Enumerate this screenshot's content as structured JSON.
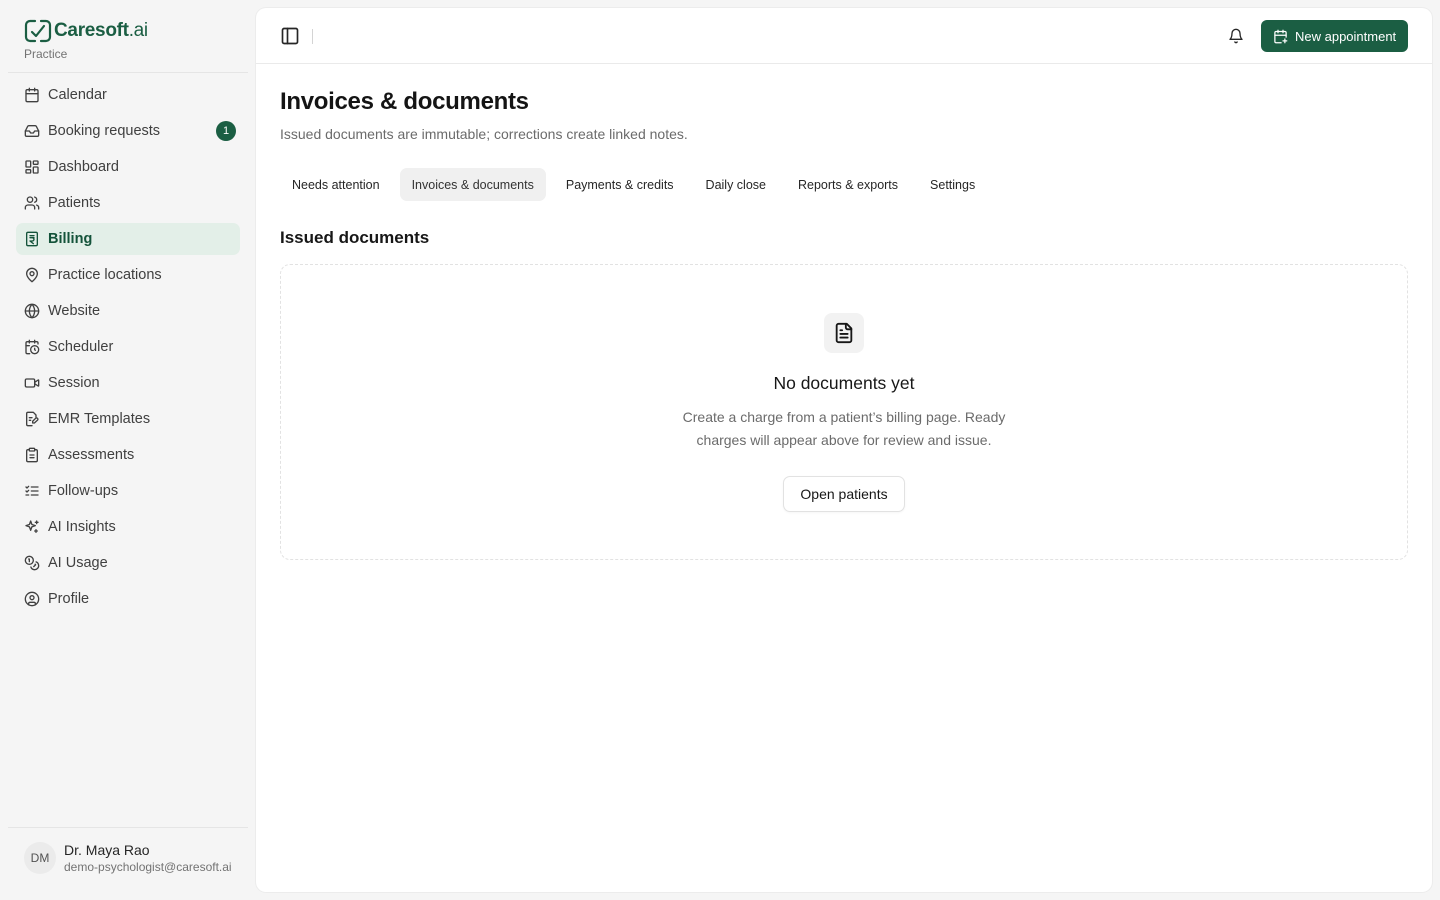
{
  "brand": {
    "name": "Caresoft",
    "name_suffix": ".ai",
    "subtitle": "Practice",
    "color": "#1b5e43"
  },
  "sidebar": {
    "items": [
      {
        "label": "Calendar",
        "icon": "calendar-icon"
      },
      {
        "label": "Booking requests",
        "icon": "inbox-icon",
        "badge": "1"
      },
      {
        "label": "Dashboard",
        "icon": "dashboard-icon"
      },
      {
        "label": "Patients",
        "icon": "users-icon"
      },
      {
        "label": "Billing",
        "icon": "receipt-icon",
        "active": true
      },
      {
        "label": "Practice locations",
        "icon": "map-pin-icon"
      },
      {
        "label": "Website",
        "icon": "globe-icon"
      },
      {
        "label": "Scheduler",
        "icon": "calendar-clock-icon"
      },
      {
        "label": "Session",
        "icon": "video-icon"
      },
      {
        "label": "EMR Templates",
        "icon": "edit-document-icon"
      },
      {
        "label": "Assessments",
        "icon": "clipboard-icon"
      },
      {
        "label": "Follow-ups",
        "icon": "list-check-icon"
      },
      {
        "label": "AI Insights",
        "icon": "sparkles-icon"
      },
      {
        "label": "AI Usage",
        "icon": "coins-icon"
      },
      {
        "label": "Profile",
        "icon": "user-circle-icon"
      }
    ]
  },
  "user": {
    "initials": "DM",
    "name": "Dr. Maya Rao",
    "email": "demo-psychologist@caresoft.ai"
  },
  "topbar": {
    "new_appointment_label": "New appointment"
  },
  "page": {
    "title": "Invoices & documents",
    "subtitle": "Issued documents are immutable; corrections create linked notes."
  },
  "tabs": [
    {
      "label": "Needs attention"
    },
    {
      "label": "Invoices & documents",
      "active": true
    },
    {
      "label": "Payments & credits"
    },
    {
      "label": "Daily close"
    },
    {
      "label": "Reports & exports"
    },
    {
      "label": "Settings"
    }
  ],
  "section": {
    "title": "Issued documents"
  },
  "empty_state": {
    "icon": "file-text-icon",
    "title": "No documents yet",
    "description": "Create a charge from a patient’s billing page. Ready charges will appear above for review and issue.",
    "button_label": "Open patients"
  }
}
